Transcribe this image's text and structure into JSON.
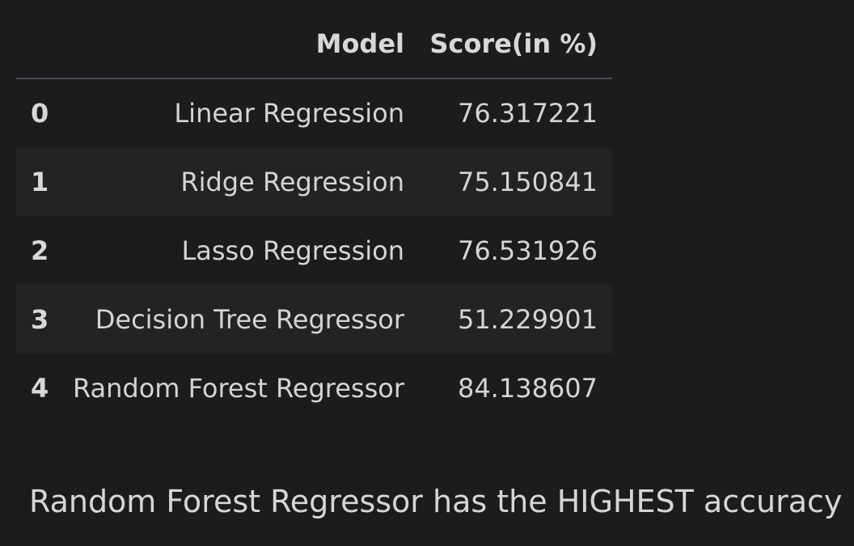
{
  "table": {
    "index_header": "",
    "columns": [
      "Model",
      "Score(in %)"
    ],
    "rows": [
      {
        "index": "0",
        "model": "Linear Regression",
        "score": "76.317221"
      },
      {
        "index": "1",
        "model": "Ridge Regression",
        "score": "75.150841"
      },
      {
        "index": "2",
        "model": "Lasso Regression",
        "score": "76.531926"
      },
      {
        "index": "3",
        "model": "Decision Tree Regressor",
        "score": "51.229901"
      },
      {
        "index": "4",
        "model": "Random Forest Regressor",
        "score": "84.138607"
      }
    ]
  },
  "summary_text": "Random Forest Regressor has the HIGHEST accuracy",
  "colors": {
    "background": "#1b1c1e",
    "stripe": "#222325",
    "text": "#d6d6d6",
    "header_rule": "#4a4c50"
  }
}
